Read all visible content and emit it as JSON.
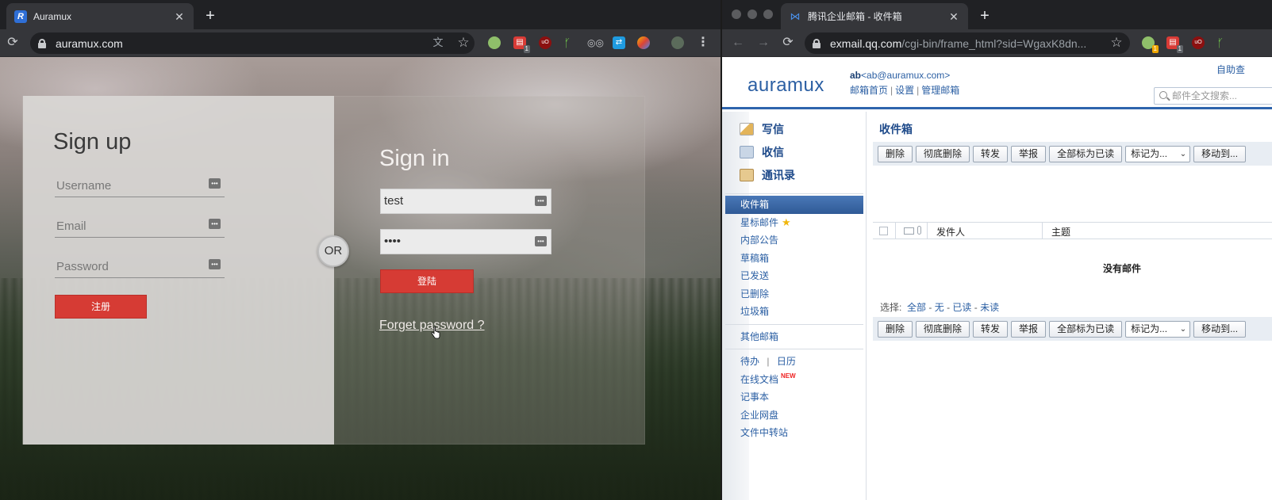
{
  "left_window": {
    "tab_title": "Auramux",
    "url": "auramux.com",
    "signup": {
      "title": "Sign up",
      "username_placeholder": "Username",
      "email_placeholder": "Email",
      "password_placeholder": "Password",
      "submit_label": "注册"
    },
    "or_label": "OR",
    "signin": {
      "title": "Sign in",
      "username_value": "test",
      "password_value": "••••",
      "submit_label": "登陆",
      "forget_link": "Forget password ?"
    },
    "extensions": [
      "translate-icon",
      "star-icon",
      "circle-ext-icon",
      "todo-ext-icon",
      "ublock-icon",
      "plant-ext-icon",
      "glasses-ext-icon",
      "sync-ext-icon",
      "color-ext-icon",
      "profile-avatar-icon",
      "menu-icon"
    ],
    "badge_count": "1"
  },
  "right_window": {
    "tab_title": "腾讯企业邮箱 - 收件箱",
    "url_host": "exmail.qq.com",
    "url_path": "/cgi-bin/frame_html?sid=WgaxK8dn...",
    "badge_count": "1",
    "badge_count_2": "1",
    "header": {
      "logo": "auramux",
      "account_name": "ab",
      "account_email": "<ab@auramux.com>",
      "link_home": "邮箱首页",
      "link_settings": "设置",
      "link_admin": "管理邮箱",
      "sep": "|",
      "self_help": "自助查",
      "search_placeholder": "邮件全文搜索..."
    },
    "sidebar": {
      "compose": "写信",
      "receive": "收信",
      "contacts": "通讯录",
      "folders": [
        "收件箱",
        "星标邮件",
        "内部公告",
        "草稿箱",
        "已发送",
        "已删除",
        "垃圾箱"
      ],
      "other_mail": "其他邮箱",
      "todo": "待办",
      "calendar": "日历",
      "todo_sep": "|",
      "docs": "在线文档",
      "docs_badge": "NEW",
      "notes": "记事本",
      "netdisk": "企业网盘",
      "transfer": "文件中转站"
    },
    "main": {
      "title": "收件箱",
      "buttons": [
        "删除",
        "彻底删除",
        "转发",
        "举报",
        "全部标为已读"
      ],
      "mark_as": "标记为...",
      "move_to": "移动到...",
      "col_sender": "发件人",
      "col_subject": "主题",
      "empty_text": "没有邮件",
      "select_label": "选择:",
      "select_all": "全部",
      "select_none": "无",
      "select_read": "已读",
      "select_unread": "未读",
      "dash": "-"
    }
  }
}
